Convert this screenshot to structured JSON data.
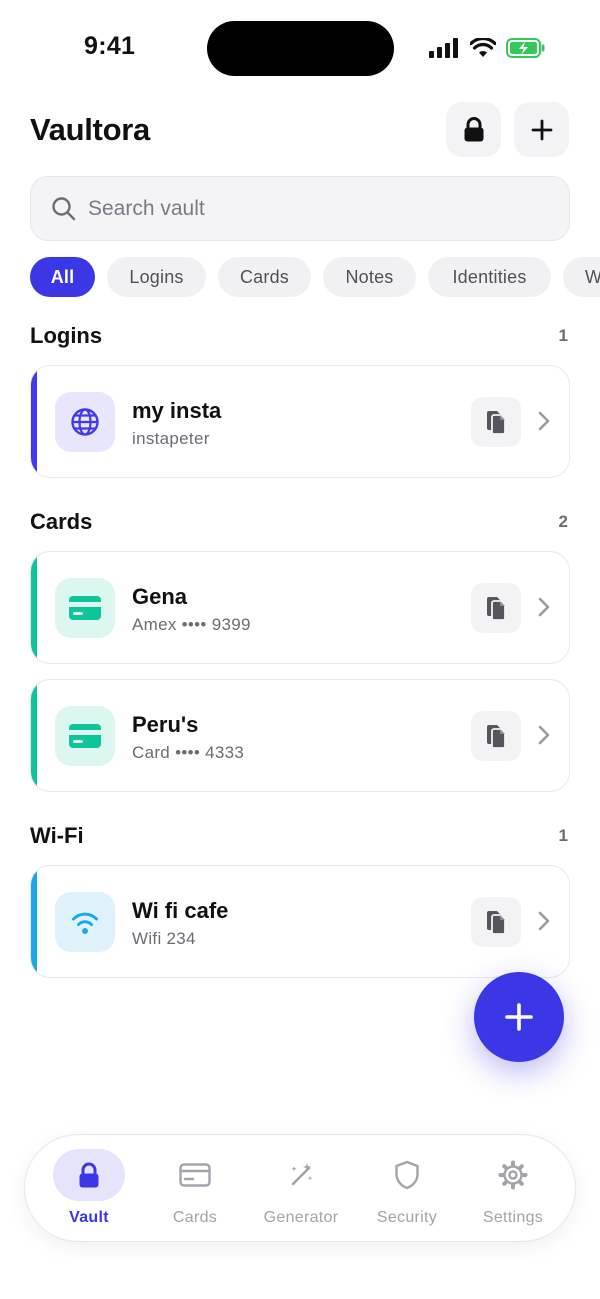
{
  "status_bar": {
    "time": "9:41"
  },
  "header": {
    "title": "Vaultora"
  },
  "search": {
    "placeholder": "Search vault"
  },
  "filters": [
    "All",
    "Logins",
    "Cards",
    "Notes",
    "Identities",
    "W"
  ],
  "sections": [
    {
      "title": "Logins",
      "count": "1",
      "items": [
        {
          "name": "my insta",
          "subtitle": "instapeter",
          "icon": "globe-icon"
        }
      ]
    },
    {
      "title": "Cards",
      "count": "2",
      "items": [
        {
          "name": "Gena",
          "subtitle": "Amex •••• 9399",
          "icon": "credit-card-icon"
        },
        {
          "name": "Peru's",
          "subtitle": "Card •••• 4333",
          "icon": "credit-card-icon"
        }
      ]
    },
    {
      "title": "Wi-Fi",
      "count": "1",
      "items": [
        {
          "name": "Wi fi cafe",
          "subtitle": "Wifi 234",
          "icon": "wifi-icon"
        }
      ]
    }
  ],
  "tabs": [
    {
      "label": "Vault",
      "icon": "lock-icon",
      "active": true
    },
    {
      "label": "Cards",
      "icon": "card-icon"
    },
    {
      "label": "Generator",
      "icon": "magic-wand-icon"
    },
    {
      "label": "Security",
      "icon": "shield-icon"
    },
    {
      "label": "Settings",
      "icon": "gear-icon"
    }
  ],
  "colors": {
    "accent": "#3b36e6",
    "login_accent": "#4338ea",
    "card_accent": "#10c49a",
    "wifi_accent": "#1aa8e8"
  }
}
